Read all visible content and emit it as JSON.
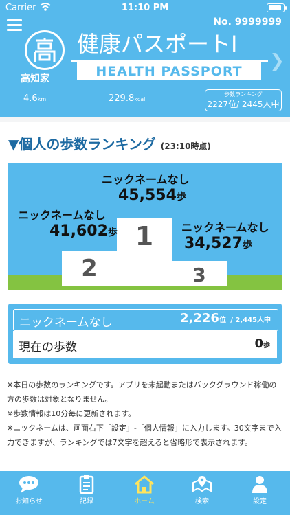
{
  "status_bar": {
    "carrier": "Carrier",
    "time": "11:10 PM"
  },
  "header": {
    "member_no": "No. 9999999",
    "logo_text": "高知家",
    "title_jp": "健康パスポートⅠ",
    "title_en": "HEALTH PASSPORT",
    "distance": "4.6",
    "distance_unit": "km",
    "calories": "229.8",
    "calories_unit": "kcal",
    "ranking_label": "歩数ランキング",
    "ranking_value": "2227位/ 2445人中"
  },
  "ranking": {
    "title": "▼個人の歩数ランキング",
    "time_note": "(23:10時点)",
    "steps_suffix": "歩",
    "top": [
      {
        "rank": "1",
        "name": "ニックネームなし",
        "steps": "45,554"
      },
      {
        "rank": "2",
        "name": "ニックネームなし",
        "steps": "41,602"
      },
      {
        "rank": "3",
        "name": "ニックネームなし",
        "steps": "34,527"
      }
    ],
    "me": {
      "name": "ニックネームなし",
      "rank": "2,226",
      "rank_suffix": "位",
      "total": "/ 2,445人中",
      "steps_label": "現在の歩数",
      "steps": "0",
      "steps_suffix": "歩"
    }
  },
  "notes": [
    "※本日の歩数のランキングです。アプリを未起動またはバックグラウンド稼働の方の歩数は対象となりません。",
    "※歩数情報は10分毎に更新されます。",
    "※ニックネームは、画面右下「設定」-「個人情報」に入力します。30文字まで入力できますが、ランキングでは7文字を超えると省略形で表示されます。"
  ],
  "tabs": [
    {
      "label": "お知らせ",
      "icon": "speech-bubble-icon"
    },
    {
      "label": "記録",
      "icon": "clipboard-icon"
    },
    {
      "label": "ホーム",
      "icon": "house-icon"
    },
    {
      "label": "検索",
      "icon": "map-pin-icon"
    },
    {
      "label": "設定",
      "icon": "person-icon"
    }
  ],
  "colors": {
    "primary": "#56b9ec",
    "heading": "#1d6aa2",
    "active_tab": "#ffe45d",
    "grass": "#84c341"
  }
}
